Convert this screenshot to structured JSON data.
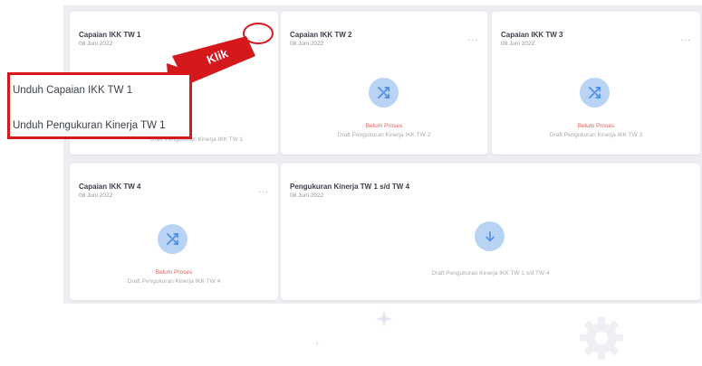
{
  "cards": [
    {
      "title": "Capaian IKK TW 1",
      "date": "08 Juni 2022",
      "menu": "...",
      "status": "",
      "subtitle": "Draft Pengukuran Kinerja IKK TW 1"
    },
    {
      "title": "Capaian IKK TW 2",
      "date": "08 Juni 2022",
      "menu": "...",
      "status": "Belum Proses",
      "subtitle": "Draft Pengukuran Kinerja IKK TW 2"
    },
    {
      "title": "Capaian IKK TW 3",
      "date": "08 Juni 2022",
      "menu": "...",
      "status": "Belum Proses",
      "subtitle": "Draft Pengukuran Kinerja IKK TW 3"
    },
    {
      "title": "Capaian IKK TW 4",
      "date": "08 Juni 2022",
      "menu": "...",
      "status": "Belum Proses",
      "subtitle": "Draft Pengukuran Kinerja IKK TW 4"
    },
    {
      "title": "Pengukuran Kinerja TW 1 s/d TW 4",
      "date": "08 Juni 2022",
      "subtitle": "Draft Pengukuran Kinerja IKK TW 1 s/d TW 4"
    }
  ],
  "popup": {
    "items": [
      "Unduh Capaian IKK TW 1",
      "Unduh Pengukuran Kinerja TW 1"
    ]
  },
  "annotation": {
    "label": "Klik",
    "color": "#d4181c"
  },
  "colors": {
    "accent": "#b9d3f4",
    "icon": "#4d8fe6",
    "status": "#e65a5a"
  },
  "icons": {
    "shuffle": "shuffle-icon",
    "download": "download-icon",
    "gear": "gear-icon",
    "sparkle": "sparkle-icon"
  }
}
